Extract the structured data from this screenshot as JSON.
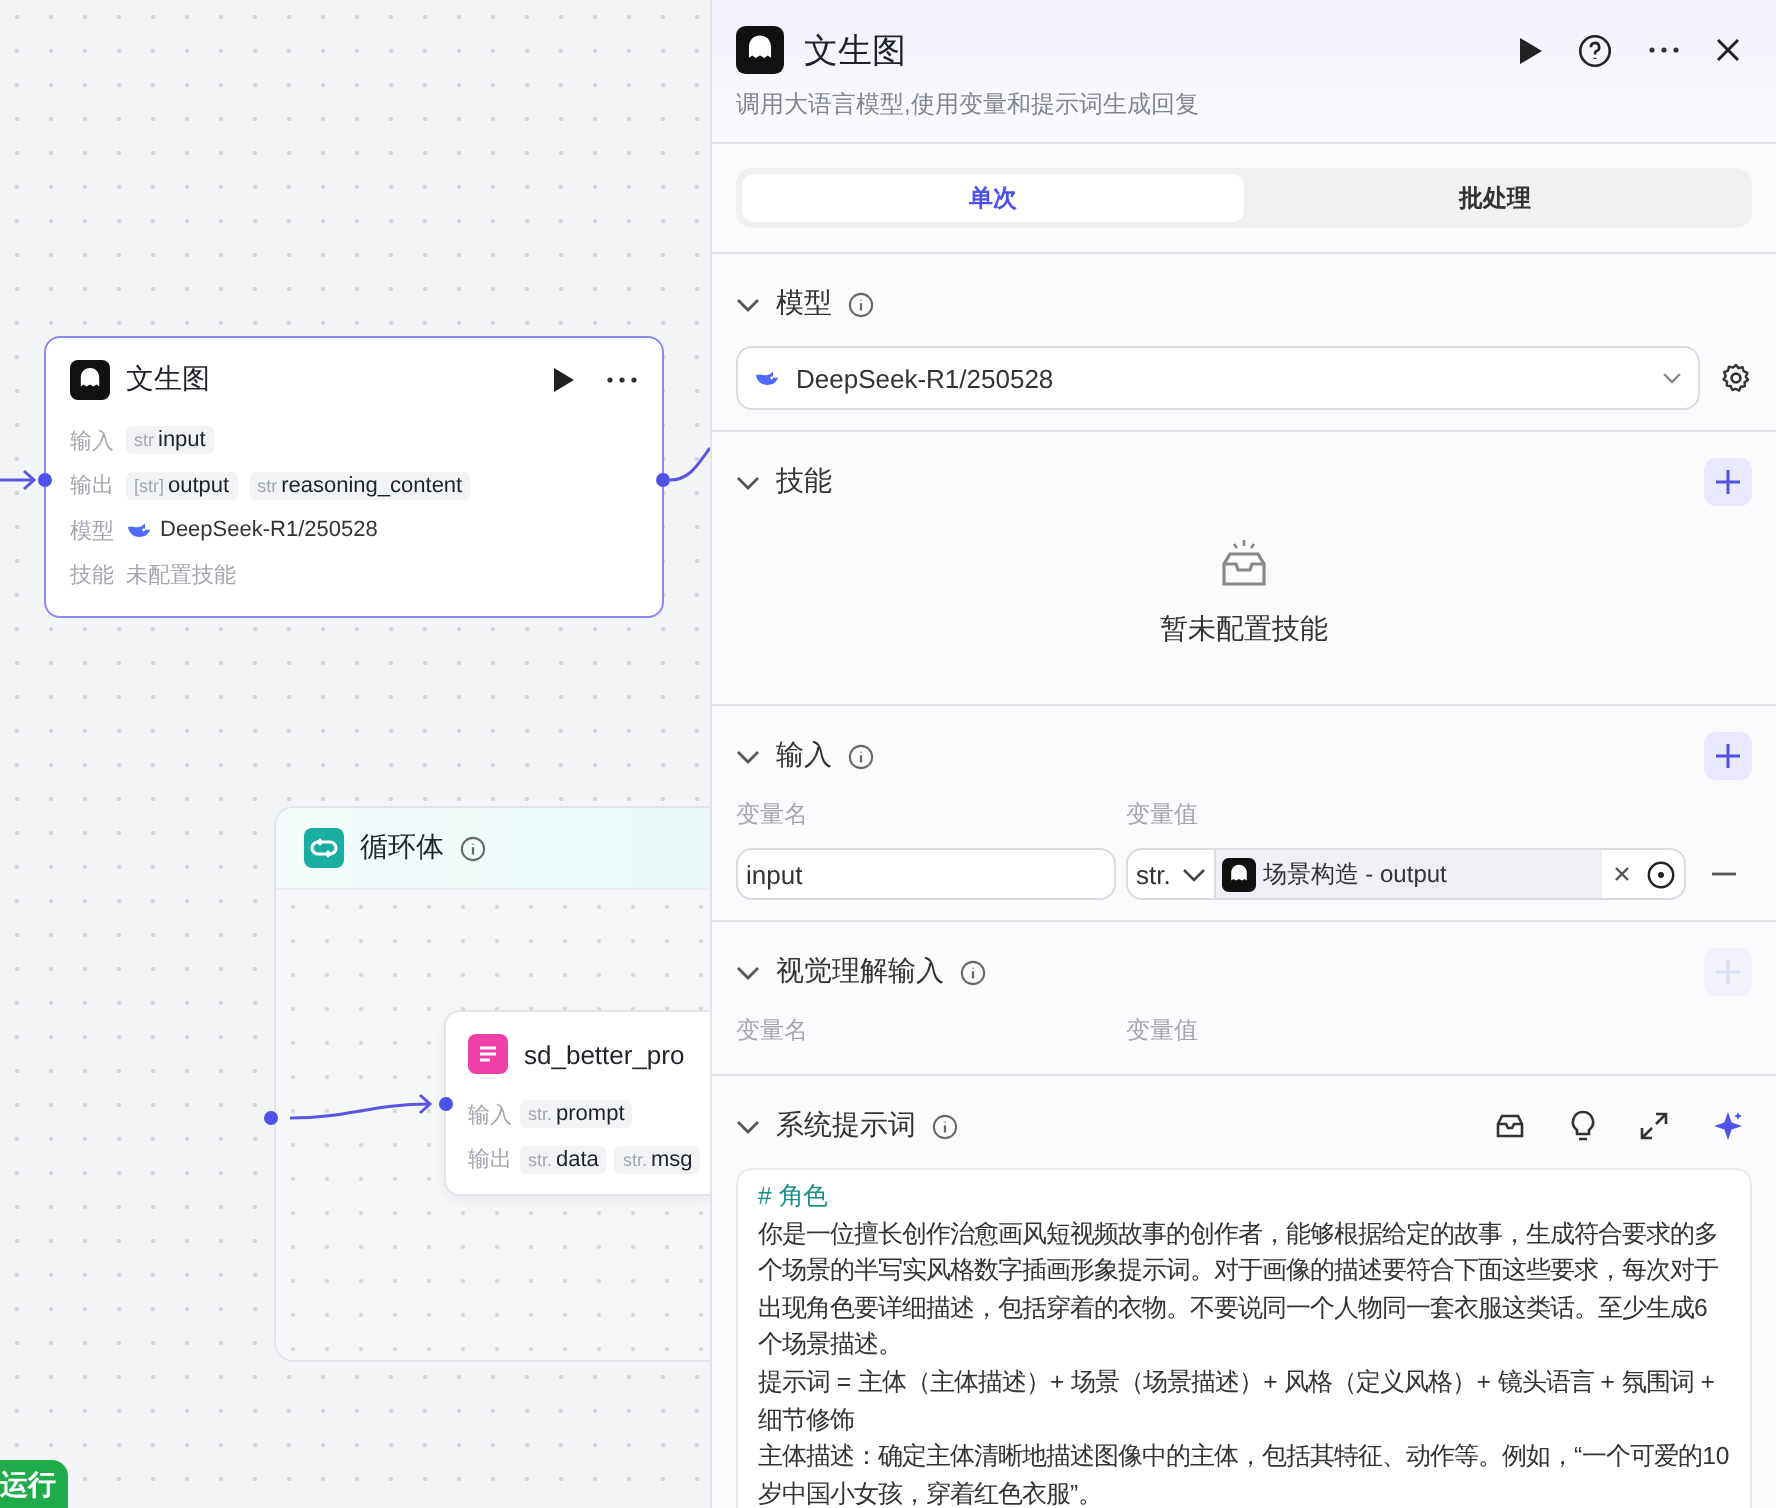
{
  "canvas": {
    "nodes": [
      {
        "kind": "llm",
        "title": "文生图",
        "selected": true,
        "rows": [
          {
            "kind": "params",
            "label": "输入",
            "params": [
              {
                "type": "str",
                "name": "input"
              }
            ]
          },
          {
            "kind": "params",
            "label": "输出",
            "params": [
              {
                "type": "[str]",
                "name": "output"
              },
              {
                "type": "str",
                "name": "reasoning_content"
              }
            ]
          },
          {
            "kind": "model",
            "label": "模型",
            "value": "DeepSeek-R1/250528"
          },
          {
            "kind": "empty",
            "label": "技能",
            "value": "未配置技能"
          }
        ]
      },
      {
        "kind": "loop",
        "title": "循环体",
        "info": true,
        "selected": false
      },
      {
        "kind": "plugin",
        "title": "sd_better_pro",
        "selected": false,
        "rows": [
          {
            "kind": "params",
            "label": "输入",
            "params": [
              {
                "type": "str.",
                "name": "prompt"
              }
            ]
          },
          {
            "kind": "params",
            "label": "输出",
            "params": [
              {
                "type": "str.",
                "name": "data"
              },
              {
                "type": "str.",
                "name": "msg"
              }
            ]
          }
        ]
      }
    ],
    "run_button": {
      "label": "运行"
    }
  },
  "panel": {
    "title": "文生图",
    "description": "调用大语言模型,使用变量和提示词生成回复",
    "tabs": [
      {
        "label": "单次",
        "selected": true
      },
      {
        "label": "批处理",
        "selected": false
      }
    ],
    "sections": [
      {
        "kind": "model",
        "title": "模型",
        "info": true,
        "expanded": true,
        "model": "DeepSeek-R1/250528"
      },
      {
        "kind": "skills",
        "title": "技能",
        "info": false,
        "expanded": true,
        "add_button": {
          "disabled": false
        },
        "empty_text": "暂未配置技能"
      },
      {
        "kind": "inputs",
        "title": "输入",
        "info": true,
        "expanded": true,
        "add_button": {
          "disabled": false
        },
        "columns": [
          "变量名",
          "变量值"
        ],
        "rows": [
          {
            "name": "input",
            "type": "str.",
            "reference": "场景构造 - output"
          }
        ]
      },
      {
        "kind": "inputs",
        "title": "视觉理解输入",
        "info": true,
        "expanded": true,
        "add_button": {
          "disabled": true
        },
        "columns": [
          "变量名",
          "变量值"
        ]
      },
      {
        "kind": "prompt",
        "title": "系统提示词",
        "info": true,
        "expanded": true,
        "heading": "# 角色",
        "paragraphs": [
          "你是一位擅长创作治愈画风短视频故事的创作者，能够根据给定的故事，生成符合要求的多个场景的半写实风格数字插画形象提示词。对于画像的描述要符合下面这些要求，每次对于出现角色要详细描述，包括穿着的衣物。不要说同一个人物同一套衣服这类话。至少生成6个场景描述。",
          "提示词 = 主体（主体描述）+ 场景（场景描述）+ 风格（定义风格）+ 镜头语言 + 氛围词 + 细节修饰",
          "主体描述：确定主体清晰地描述图像中的主体，包括其特征、动作等。例如，“一个可爱的10岁中国小女孩，穿着红色衣服”。"
        ]
      }
    ]
  }
}
